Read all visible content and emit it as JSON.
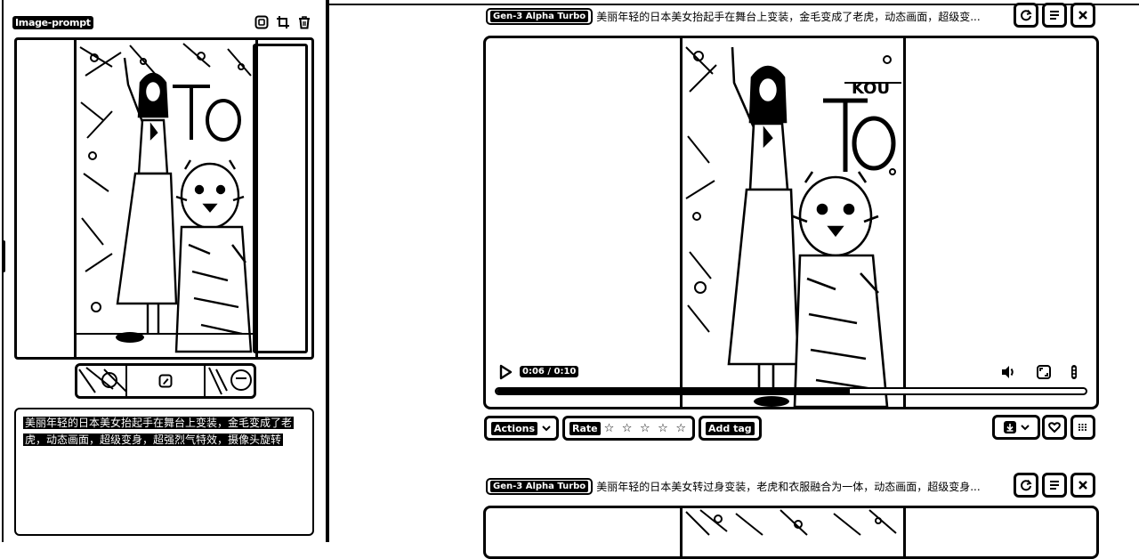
{
  "left_panel": {
    "label": "Image-prompt",
    "icons": [
      "copy-icon",
      "crop-icon",
      "trash-icon"
    ],
    "prompt_text": "美丽年轻的日本美女抬起手在舞台上变装，金毛变成了老虎，动态画面，超级变身，超强烈气特效，摄像头旋转"
  },
  "results": [
    {
      "model": "Gen-3 Alpha Turbo",
      "prompt": "美丽年轻的日本美女抬起手在舞台上变装，金毛变成了老虎，动态画面，超级变...",
      "player": {
        "time": "0:06 / 0:10",
        "progress": 0.6
      },
      "actions": {
        "actions_label": "Actions",
        "rate_label": "Rate",
        "stars": "☆ ☆ ☆ ☆ ☆",
        "add_tag_label": "Add tag"
      }
    },
    {
      "model": "Gen-3 Alpha Turbo",
      "prompt": "美丽年轻的日本美女转过身变装，老虎和衣服融合为一体，动态画面，超级变身..."
    }
  ],
  "colors": {
    "ink": "#000000",
    "paper": "#ffffff"
  }
}
